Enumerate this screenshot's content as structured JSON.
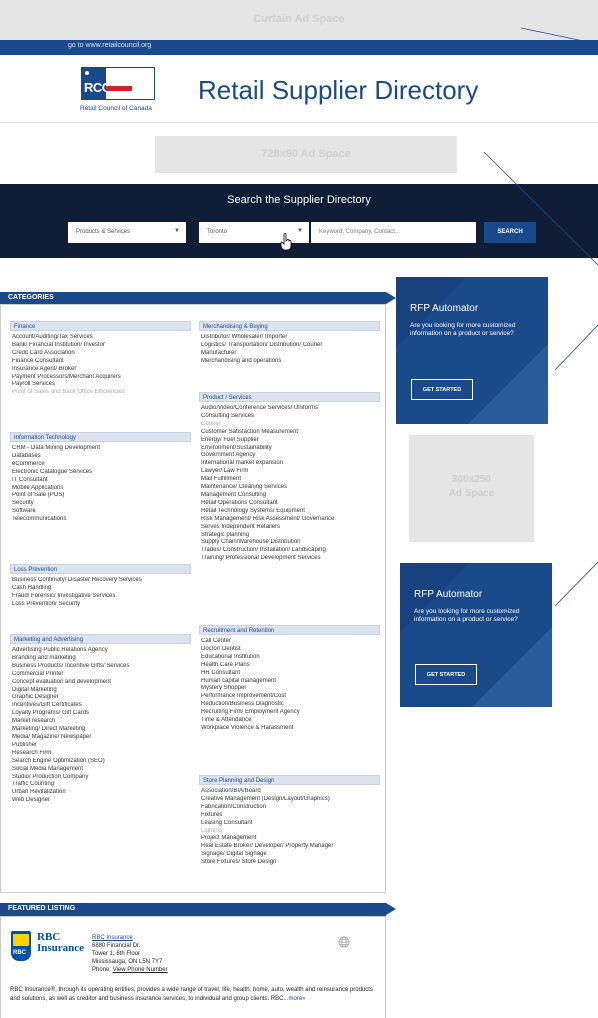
{
  "ads": {
    "curtain_label": "Curtain Ad Space",
    "leaderboard_label": "728x90 Ad Space",
    "medium_rect_line1": "300x250",
    "medium_rect_line2": "Ad Space"
  },
  "topbar": {
    "url": "go to www.retailcouncil.org"
  },
  "header": {
    "logo_text": "RCC",
    "logo_caption": "Retail Council of Canada",
    "title": "Retail Supplier Directory"
  },
  "search": {
    "title": "Search the Supplier Directory",
    "category_select": "Products & Services",
    "location_select": "Toronto",
    "keyword_placeholder": "Keyword, Company, Contact...",
    "button_label": "SEARCH"
  },
  "categories": {
    "header": "CATEGORIES",
    "left": [
      {
        "title": "Finance",
        "items": [
          {
            "label": "Account/Auditing/Tax Services"
          },
          {
            "label": "Bank/ Financial Institution/ Investor"
          },
          {
            "label": "Credit Card Association"
          },
          {
            "label": "Finance Consultant"
          },
          {
            "label": "Insurance Agent/ Broker"
          },
          {
            "label": "Payment Processors/Merchant Acquirers"
          },
          {
            "label": "Payroll Services"
          },
          {
            "label": "Point of Sales and Back Office Efficiencies",
            "muted": true
          }
        ]
      },
      {
        "title": "Information Technology",
        "items": [
          {
            "label": "CRM - Data Mining Development"
          },
          {
            "label": "Databases"
          },
          {
            "label": "eCommerce"
          },
          {
            "label": "Electronic Catalogue Services"
          },
          {
            "label": "IT Consultant"
          },
          {
            "label": "Mobile Applications"
          },
          {
            "label": "Point of Sale (POS)"
          },
          {
            "label": "Security"
          },
          {
            "label": "Software"
          },
          {
            "label": "Telecommunications"
          }
        ]
      },
      {
        "title": "Loss Prevention",
        "items": [
          {
            "label": "Business Continuity/ Disaster Recovery Services"
          },
          {
            "label": "Cash Handling"
          },
          {
            "label": "Fraud/ Forensic/ Investigative Services"
          },
          {
            "label": "Loss Prevention/ Security"
          }
        ]
      },
      {
        "title": "Marketing and Advertising",
        "items": [
          {
            "label": "Advertising Public Relations Agency"
          },
          {
            "label": "Branding and marketing"
          },
          {
            "label": "Business Products/ Incentive Gifts/ Services"
          },
          {
            "label": "Commercial Printer"
          },
          {
            "label": "Concept evaluation and development"
          },
          {
            "label": "Digital Marketing"
          },
          {
            "label": "Graphic Designer"
          },
          {
            "label": "Incentives/Gift Certificates"
          },
          {
            "label": "Loyalty Programs/ Gift Cards"
          },
          {
            "label": "Market research"
          },
          {
            "label": "Marketing/ Direct Marketing"
          },
          {
            "label": "Media/ Magazine/ Newspaper"
          },
          {
            "label": "Publisher"
          },
          {
            "label": "Research Firm"
          },
          {
            "label": "Search Engine Optimization (SEO)"
          },
          {
            "label": "Social Media Management"
          },
          {
            "label": "Studio/ Production Company"
          },
          {
            "label": "Traffic Counting"
          },
          {
            "label": "Urban Revitalization"
          },
          {
            "label": "Web Designer"
          }
        ]
      }
    ],
    "right": [
      {
        "title": "Merchandising & Buying",
        "items": [
          {
            "label": "Distributor/ Wholesaler/ Importer"
          },
          {
            "label": "Logistics/ Transportation/ Distribution/ Courier"
          },
          {
            "label": "Manufacturer"
          },
          {
            "label": "Merchandising and operations"
          }
        ]
      },
      {
        "title": "Product / Services",
        "items": [
          {
            "label": "Audio/Video/Conference Services/ Uniforms"
          },
          {
            "label": "Consulting Services"
          },
          {
            "label": "Courier",
            "muted": true
          },
          {
            "label": "Customer Satisfaction Measurement"
          },
          {
            "label": "Energy/ Fuel Supplier"
          },
          {
            "label": "Environment/Sustainability"
          },
          {
            "label": "Government Agency"
          },
          {
            "label": "International market expansion"
          },
          {
            "label": "Lawyer/ Law Firm"
          },
          {
            "label": "Mail Fulfillment"
          },
          {
            "label": "Maintenance/ Cleaning Services"
          },
          {
            "label": "Management Consulting"
          },
          {
            "label": "Retail Operations Consultant"
          },
          {
            "label": "Retail Technology Systems/ Equipment"
          },
          {
            "label": "Risk Management/ Risk Assessment/ Governance"
          },
          {
            "label": "Serves Independent Retailers"
          },
          {
            "label": "Strategic planning"
          },
          {
            "label": "Supply Chain/Warehouse Distribution"
          },
          {
            "label": "Trades/ Construction/ Installation/ Landscaping"
          },
          {
            "label": "Training/ Professional Development Services"
          }
        ]
      },
      {
        "title": "Recruitment and Retention",
        "items": [
          {
            "label": "Call Center"
          },
          {
            "label": "Doctor/ Dentist"
          },
          {
            "label": "Educational Institution"
          },
          {
            "label": "Health Care Plans"
          },
          {
            "label": "HR Consultant"
          },
          {
            "label": "Human capital management"
          },
          {
            "label": "Mystery Shopper"
          },
          {
            "label": "Performance Improvement/Cost"
          },
          {
            "label": "Reduction/Business Diagnostic"
          },
          {
            "label": "Recruiting Firm/ Employment Agency"
          },
          {
            "label": "Time & Attendance"
          },
          {
            "label": "Workplace Violence & Harassment"
          }
        ]
      },
      {
        "title": "Store Planning and Design",
        "items": [
          {
            "label": "Association/BIA/Board"
          },
          {
            "label": "Creative Management (Design/Layout/Graphics)"
          },
          {
            "label": "Fabrication/Construction"
          },
          {
            "label": "Fixtures"
          },
          {
            "label": "Leasing Consultant"
          },
          {
            "label": "Lighting",
            "muted": true
          },
          {
            "label": "Project Management"
          },
          {
            "label": "Real Estate Broker/ Developer/ Property Manager"
          },
          {
            "label": "Signage/ Digital Signage"
          },
          {
            "label": "Store Fixtures/ Store Design"
          }
        ]
      }
    ]
  },
  "rfp": {
    "title": "RFP Automator",
    "description": "Are you looking for more customized information on a product or service?",
    "button": "GET STARTED"
  },
  "featured": {
    "header": "FEATURED LISTING",
    "logo_word1": "RBC",
    "logo_word2": "Insurance",
    "logo_badge": "RBC",
    "name": "RBC Insurance",
    "address1": "6880 Financial Dr.",
    "address2": "Tower 1, 6th Floor",
    "address3": "Mississauga, ON L5N 7Y7",
    "phone_label": "Phone:",
    "phone_link": "View Phone Number",
    "description": "RBC Insurance®, through its operating entities, provides a wide range of travel, life, health, home, auto, wealth and reinsurance products and solutions, as well as creditor and business insurance services, to individual and group clients. RBC...",
    "more": "more»"
  },
  "colors": {
    "brand_blue": "#1a4a8a",
    "search_bg": "#0f1e36",
    "rcc_red": "#d2232a"
  }
}
